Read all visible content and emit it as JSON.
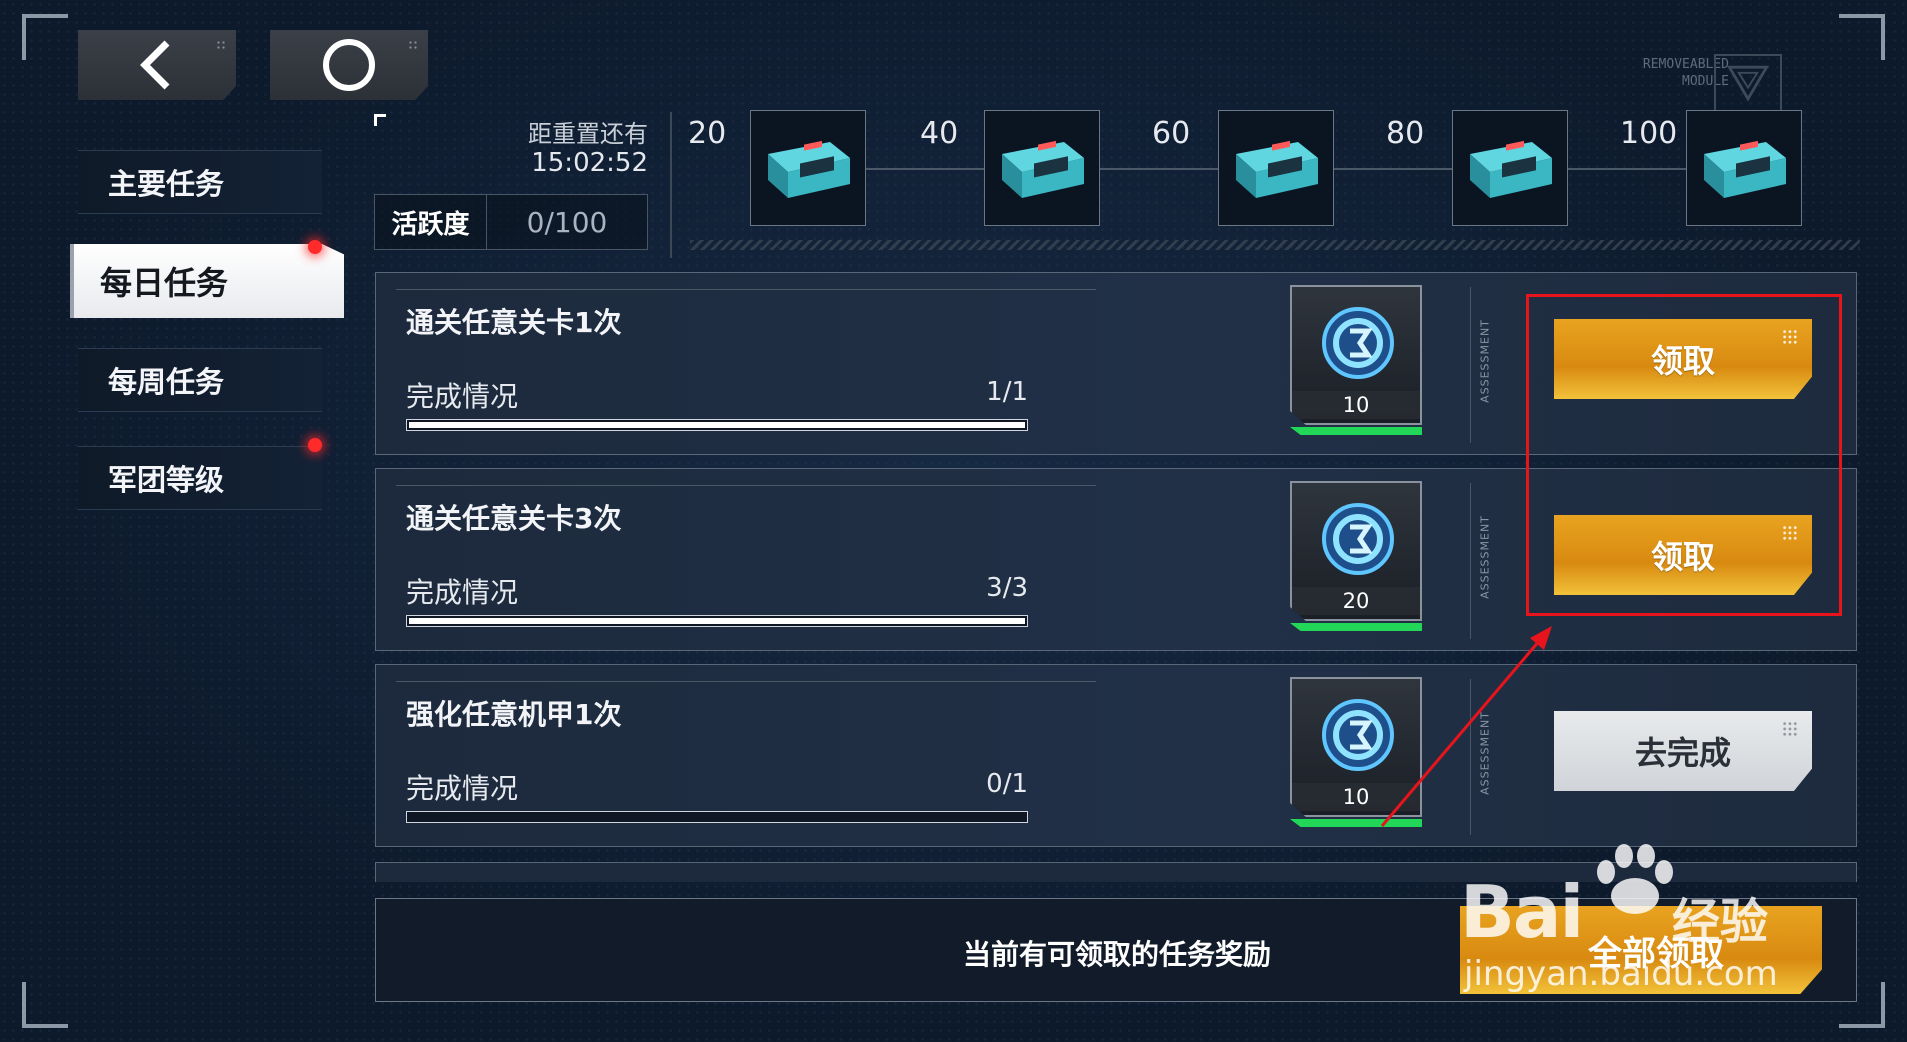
{
  "nav": {
    "back_icon": "chevron-left-icon",
    "home_icon": "circle-icon"
  },
  "deco": {
    "line1": "REMOVEABLED",
    "line2": "MODULE"
  },
  "sidebar": {
    "items": [
      {
        "label": "主要任务",
        "active": false,
        "badge": false
      },
      {
        "label": "每日任务",
        "active": true,
        "badge": true
      },
      {
        "label": "每周任务",
        "active": false,
        "badge": false
      },
      {
        "label": "军团等级",
        "active": false,
        "badge": true
      }
    ]
  },
  "activity": {
    "reset_label": "距重置还有",
    "reset_time": "15:02:52",
    "label": "活跃度",
    "value": "0/100",
    "milestones": [
      {
        "label": "20",
        "icon": "supply-chest-icon"
      },
      {
        "label": "40",
        "icon": "supply-chest-icon"
      },
      {
        "label": "60",
        "icon": "supply-chest-icon"
      },
      {
        "label": "80",
        "icon": "supply-chest-icon"
      },
      {
        "label": "100",
        "icon": "supply-chest-icon"
      }
    ]
  },
  "tasks": [
    {
      "title": "通关任意关卡1次",
      "progress_label": "完成情况",
      "progress": "1/1",
      "progress_fraction": 1.0,
      "reward_amount": "10",
      "reward_icon": "activity-coin-icon",
      "assessment": "ASSESSMENT",
      "button": "领取",
      "state": "claimable"
    },
    {
      "title": "通关任意关卡3次",
      "progress_label": "完成情况",
      "progress": "3/3",
      "progress_fraction": 1.0,
      "reward_amount": "20",
      "reward_icon": "activity-coin-icon",
      "assessment": "ASSESSMENT",
      "button": "领取",
      "state": "claimable"
    },
    {
      "title": "强化任意机甲1次",
      "progress_label": "完成情况",
      "progress": "0/1",
      "progress_fraction": 0.0,
      "reward_amount": "10",
      "reward_icon": "activity-coin-icon",
      "assessment": "ASSESSMENT",
      "button": "去完成",
      "state": "incomplete"
    }
  ],
  "footer": {
    "message": "当前有可领取的任务奖励",
    "claim_all": "全部领取"
  },
  "watermark": {
    "brand": "Bai",
    "brand_cn": "经验",
    "url": "jingyan.baidu.com"
  },
  "colors": {
    "claim": "#e9a320",
    "goto": "#e0e3e6",
    "reward_bar": "#22d657",
    "badge": "#ff2a2a",
    "annotation": "#e8141b"
  }
}
